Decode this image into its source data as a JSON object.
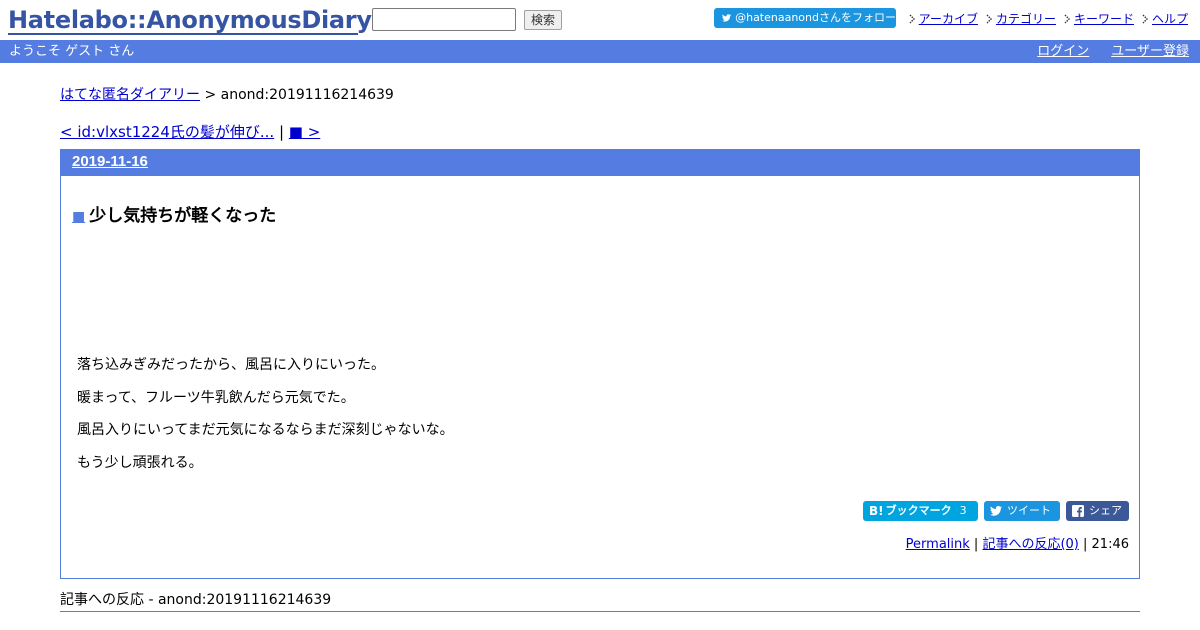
{
  "header": {
    "logo_text": "Hatelabo::AnonymousDiary",
    "search": {
      "value": "",
      "placeholder": ""
    },
    "search_button_label": "検索",
    "follow_label": "@hatenaanondさんをフォロー",
    "nav": [
      {
        "label": "アーカイブ"
      },
      {
        "label": "カテゴリー"
      },
      {
        "label": "キーワード"
      },
      {
        "label": "ヘルプ"
      }
    ]
  },
  "welcome_bar": {
    "text": "ようこそ ゲスト さん",
    "login_label": "ログイン",
    "register_label": "ユーザー登録"
  },
  "breadcrumb": {
    "home_label": "はてな匿名ダイアリー",
    "separator": " > ",
    "current": "anond:20191116214639"
  },
  "pager": {
    "prev_label": "< id:vlxst1224氏の髪が伸び...",
    "separator": " | ",
    "next_label": "■ >"
  },
  "day": {
    "date": "2019-11-16",
    "entry": {
      "title_marker": "■",
      "title": "少し気持ちが軽くなった",
      "body": [
        "落ち込みぎみだったから、風呂に入りにいった。",
        "暖まって、フルーツ牛乳飲んだら元気でた。",
        "風呂入りにいってまだ元気になるならまだ深刻じゃないな。",
        "もう少し頑張れる。"
      ],
      "share": {
        "hatena_label": "ブックマーク",
        "hatena_count": "3",
        "twitter_label": "ツイート",
        "facebook_label": "シェア"
      },
      "footer": {
        "permalink_label": "Permalink",
        "separator1": " | ",
        "reactions_label": "記事への反応(0)",
        "separator2": " | ",
        "time": "21:46"
      }
    }
  },
  "reactions": {
    "title": "記事への反応 - anond:20191116214639"
  },
  "colors": {
    "accent": "#557ce0",
    "logo": "#3654a4",
    "link": "#0000cc",
    "twitter": "#1b95e0",
    "hatena": "#00a4de",
    "facebook": "#3b5998"
  }
}
